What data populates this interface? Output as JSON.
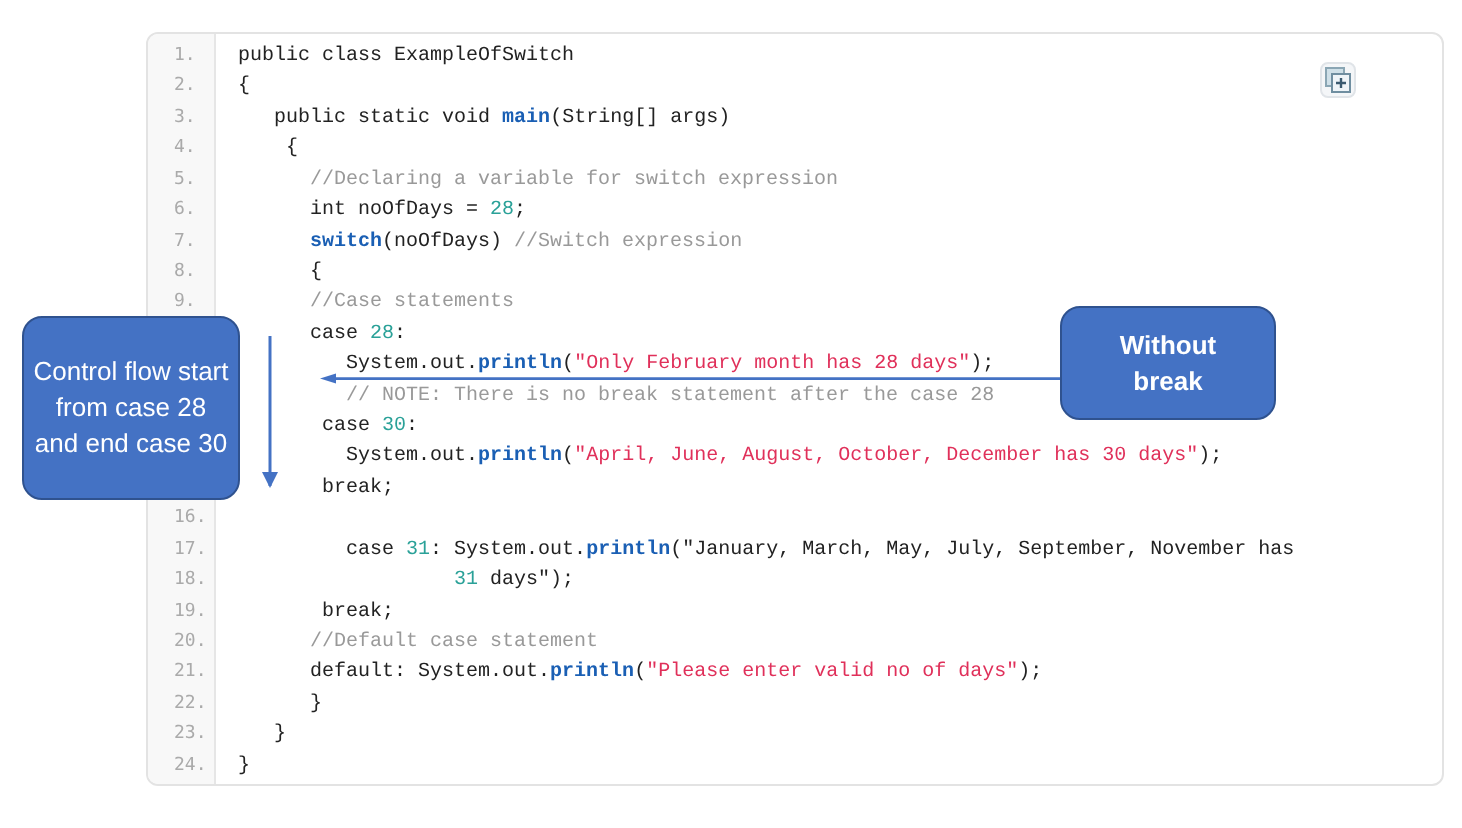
{
  "code_block": {
    "lines": [
      {
        "number": "1.",
        "tokens": [
          {
            "kind": "plain",
            "text": "public class ExampleOfSwitch"
          }
        ]
      },
      {
        "number": "2.",
        "tokens": [
          {
            "kind": "plain",
            "text": "{"
          }
        ]
      },
      {
        "number": "3.",
        "tokens": [
          {
            "kind": "plain",
            "text": "   public static void "
          },
          {
            "kind": "keyword",
            "text": "main"
          },
          {
            "kind": "plain",
            "text": "(String[] args)"
          }
        ]
      },
      {
        "number": "4.",
        "tokens": [
          {
            "kind": "plain",
            "text": "    {"
          }
        ]
      },
      {
        "number": "5.",
        "tokens": [
          {
            "kind": "comment",
            "text": "      //Declaring a variable for switch expression"
          }
        ]
      },
      {
        "number": "6.",
        "tokens": [
          {
            "kind": "plain",
            "text": "      int noOfDays = "
          },
          {
            "kind": "number",
            "text": "28"
          },
          {
            "kind": "plain",
            "text": ";"
          }
        ]
      },
      {
        "number": "7.",
        "tokens": [
          {
            "kind": "keyword",
            "text": "      switch"
          },
          {
            "kind": "plain",
            "text": "(noOfDays) "
          },
          {
            "kind": "comment",
            "text": "//Switch expression"
          }
        ]
      },
      {
        "number": "8.",
        "tokens": [
          {
            "kind": "plain",
            "text": "      {"
          }
        ]
      },
      {
        "number": "9.",
        "tokens": [
          {
            "kind": "comment",
            "text": "      //Case statements"
          }
        ]
      },
      {
        "tokens": [
          {
            "kind": "plain",
            "text": "      case "
          },
          {
            "kind": "number",
            "text": "28"
          },
          {
            "kind": "plain",
            "text": ":"
          }
        ]
      },
      {
        "tokens": [
          {
            "kind": "plain",
            "text": "         System.out."
          },
          {
            "kind": "keyword",
            "text": "println"
          },
          {
            "kind": "plain",
            "text": "("
          },
          {
            "kind": "string",
            "text": "\"Only February month has 28 days\""
          },
          {
            "kind": "plain",
            "text": ");"
          }
        ]
      },
      {
        "tokens": [
          {
            "kind": "comment",
            "text": "         // NOTE: There is no break statement after the case 28"
          }
        ]
      },
      {
        "tokens": [
          {
            "kind": "plain",
            "text": "       case "
          },
          {
            "kind": "number",
            "text": "30"
          },
          {
            "kind": "plain",
            "text": ":"
          }
        ]
      },
      {
        "tokens": [
          {
            "kind": "plain",
            "text": "         System.out."
          },
          {
            "kind": "keyword",
            "text": "println"
          },
          {
            "kind": "plain",
            "text": "("
          },
          {
            "kind": "string",
            "text": "\"April, June, August, October, December has 30 days\""
          },
          {
            "kind": "plain",
            "text": ");"
          }
        ]
      },
      {
        "tokens": [
          {
            "kind": "plain",
            "text": "       break;"
          }
        ]
      },
      {
        "number": "16."
      },
      {
        "number": "17.",
        "tokens": [
          {
            "kind": "plain",
            "text": "         case "
          },
          {
            "kind": "number",
            "text": "31"
          },
          {
            "kind": "plain",
            "text": ": System.out."
          },
          {
            "kind": "keyword",
            "text": "println"
          },
          {
            "kind": "plain",
            "text": "(\"January, March, May, July, September, November has"
          }
        ]
      },
      {
        "number": "18.",
        "tokens": [
          {
            "kind": "number",
            "text": "                  31"
          },
          {
            "kind": "plain",
            "text": " days\");"
          }
        ]
      },
      {
        "number": "19.",
        "tokens": [
          {
            "kind": "plain",
            "text": "       break;"
          }
        ]
      },
      {
        "number": "20.",
        "tokens": [
          {
            "kind": "comment",
            "text": "      //Default case statement"
          }
        ]
      },
      {
        "number": "21.",
        "tokens": [
          {
            "kind": "plain",
            "text": "      default: System.out."
          },
          {
            "kind": "keyword",
            "text": "println"
          },
          {
            "kind": "plain",
            "text": "("
          },
          {
            "kind": "string",
            "text": "\"Please enter valid no of days\""
          },
          {
            "kind": "plain",
            "text": ");"
          }
        ]
      },
      {
        "number": "22.",
        "tokens": [
          {
            "kind": "plain",
            "text": "      }"
          }
        ]
      },
      {
        "number": "23.",
        "tokens": [
          {
            "kind": "plain",
            "text": "   }"
          }
        ]
      },
      {
        "number": "24.",
        "tokens": [
          {
            "kind": "plain",
            "text": "}"
          }
        ]
      }
    ]
  },
  "callouts": [
    {
      "text": "Control flow start from case 28 and end case 30",
      "bold": false
    },
    {
      "text": "Without break",
      "bold": true
    }
  ]
}
